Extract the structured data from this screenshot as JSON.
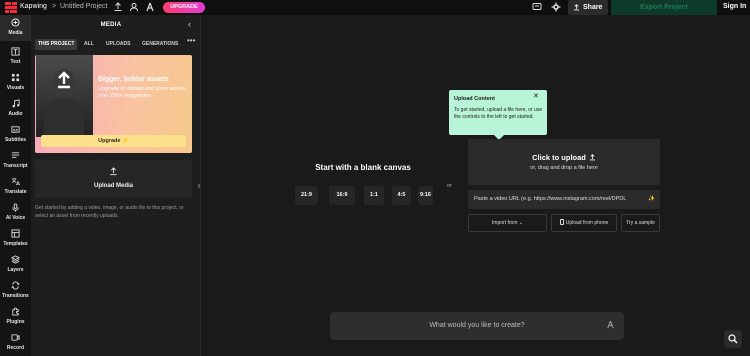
{
  "topbar": {
    "brand": "Kapwing",
    "separator": ">",
    "project_title": "Untitled Project",
    "upgrade_label": "UPGRADE",
    "share_label": "Share",
    "export_label": "Export Project",
    "signin_label": "Sign In",
    "icons": [
      "kapwing-logo-icon",
      "upload-icon",
      "user-icon",
      "person-run-icon",
      "comment-icon",
      "gear-icon"
    ]
  },
  "rail": {
    "items": [
      {
        "label": "Media",
        "icon": "plus-icon",
        "active": true
      },
      {
        "label": "Text",
        "icon": "text-icon"
      },
      {
        "label": "Visuals",
        "icon": "shapes-icon"
      },
      {
        "label": "Audio",
        "icon": "music-note-icon"
      },
      {
        "label": "Subtitles",
        "icon": "captions-icon"
      },
      {
        "label": "Transcript",
        "icon": "transcript-icon"
      },
      {
        "label": "Translate",
        "icon": "translate-icon"
      },
      {
        "label": "AI Voice",
        "icon": "microphone-icon"
      },
      {
        "label": "Templates",
        "icon": "templates-icon"
      },
      {
        "label": "Layers",
        "icon": "layers-icon"
      },
      {
        "label": "Transitions",
        "icon": "transitions-icon"
      },
      {
        "label": "Plugins",
        "icon": "plugin-icon"
      },
      {
        "label": "Record",
        "icon": "record-icon"
      }
    ]
  },
  "panel": {
    "title": "MEDIA",
    "tabs": [
      "THIS PROJECT",
      "ALL",
      "UPLOADS",
      "GENERATIONS"
    ],
    "promo": {
      "title": "Bigger, bolder assets",
      "subtitle": "Upgrade to upload and store assets over 250+ megabytes",
      "button": "Upgrade ⚡"
    },
    "upload_label": "Upload Media",
    "hint": "Get started by adding a video, image, or audio file to this project, or select an asset from recently uploads."
  },
  "canvas": {
    "title": "Start with a blank canvas",
    "ratios": [
      "21:9",
      "16:9",
      "1:1",
      "4:5",
      "9:16"
    ],
    "or_label": "or",
    "tooltip": {
      "title": "Upload Content",
      "body": "To get started, upload a file here, or use the controls to the left to get started."
    },
    "dropzone": {
      "title": "Click to upload",
      "subtitle": "or, drag and drop a file here"
    },
    "url_placeholder": "Paste a video URL (e.g. https://www.instagram.com/reel/DPDL",
    "import_from": "Import from ⌄",
    "upload_from_phone": "Upload from phone",
    "try_sample": "Try a sample"
  },
  "prompt": {
    "placeholder": "What would you like to create?"
  },
  "colors": {
    "accent_green": "#b8f5d8",
    "upgrade_gradient": "#ff3d6e",
    "export_bg": "#0d3a2b",
    "brand_red": "#ff2b3d"
  }
}
